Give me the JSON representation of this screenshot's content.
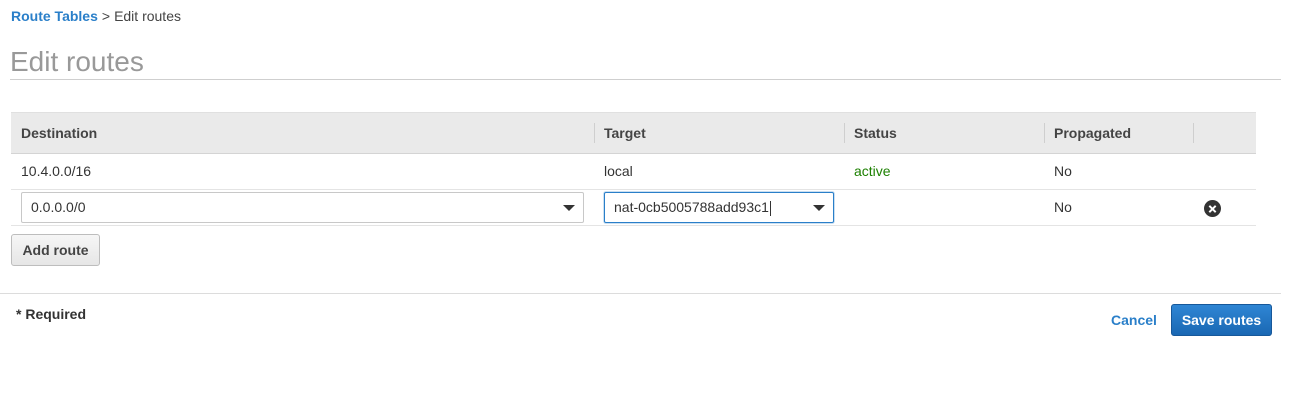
{
  "breadcrumb": {
    "parent": "Route Tables",
    "separator": ">",
    "current": "Edit routes"
  },
  "page": {
    "title": "Edit routes"
  },
  "table": {
    "columns": [
      "Destination",
      "Target",
      "Status",
      "Propagated"
    ],
    "rows": [
      {
        "destination": "10.4.0.0/16",
        "target": "local",
        "status": "active",
        "propagated": "No"
      },
      {
        "destination": "0.0.0.0/0",
        "target": "nat-0cb5005788add93c1",
        "status": "",
        "propagated": "No",
        "editable": true
      }
    ]
  },
  "actions": {
    "add_route": "Add route",
    "required_note": "* Required",
    "cancel": "Cancel",
    "save": "Save routes"
  },
  "colors": {
    "link": "#2a7fc9",
    "status_active": "#1d8102",
    "primary": "#1a68b3"
  },
  "icons": {
    "remove_row": "close-circle-icon",
    "dropdown": "chevron-down-icon"
  }
}
